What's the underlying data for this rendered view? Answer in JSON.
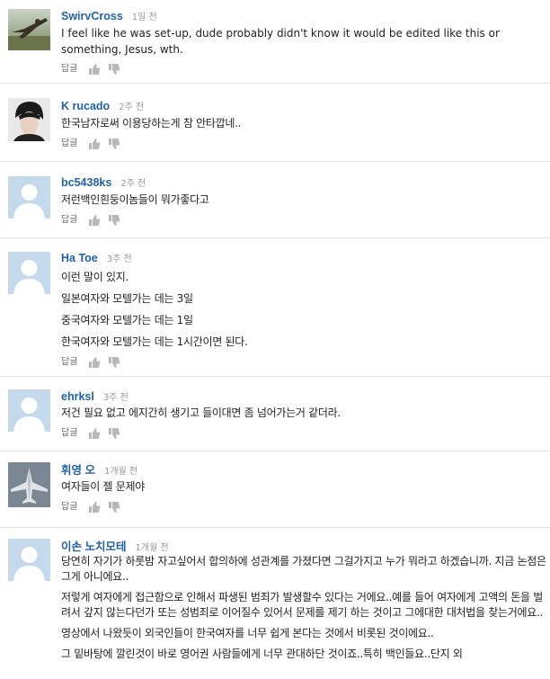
{
  "labels": {
    "reply": "답글"
  },
  "comments": [
    {
      "author": "SwirvCross",
      "time": "1일 전",
      "lines": [
        "I feel like he was set-up, dude probably didn't know it would be edited like this or something, Jesus, wth."
      ]
    },
    {
      "author": "K rucado",
      "time": "2주 전",
      "lines": [
        "한국남자로써 이용당하는게 참 안타깝네.."
      ]
    },
    {
      "author": "bc5438ks",
      "time": "2주 전",
      "lines": [
        "저런백인흰둥이놈들이 뭐가좋다고"
      ]
    },
    {
      "author": "Ha Toe",
      "time": "3주 전",
      "lines": [
        "이런 말이 있지.",
        "일본여자와 모텔가는 데는 3일",
        "중국여자와 모텔가는 데는 1일",
        "한국여자와 모텔가는 데는 1시간이면 된다."
      ]
    },
    {
      "author": "ehrksl",
      "time": "3주 전",
      "lines": [
        "저건 필요 없고 에지간히 생기고 들이대면 좀 넘어가는거 같더라."
      ]
    },
    {
      "author": "휘영 오",
      "time": "1개월 전",
      "lines": [
        "여자들이 젤 문제야"
      ]
    },
    {
      "author": "이손 노치모테",
      "time": "1개월 전",
      "lines": [
        "당연히 자기가 하룻밤 자고싶어서 합의하에 성관계를 가졌다면 그걸가지고 누가 뭐라고 하겠습니까. 지금 논점은 그게 아니에요..",
        "저렇게 여자에게 접근함으로 인해서 파생된 범죄가 발생할수 있다는 거에요..예를 들어 여자에게 고액의 돈을 벌려서 갚지 않는다던가 또는 성범죄로 이어질수 있어서 문제를 제기 하는 것이고 그에대한 대처법을 찾는거에요..",
        "영상에서 나왔듯이 외국인들이 한국여자를 너무 쉽게 본다는 것에서 비롯된 것이에요..",
        "그 밑바탕에 깔린것이 바로 영어권 사람들에게 너무 관대하단 것이죠..특히 백인들요..단지 외"
      ]
    }
  ]
}
